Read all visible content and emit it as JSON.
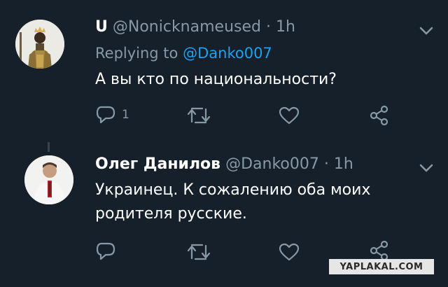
{
  "tweets": [
    {
      "name": "U",
      "handle": "@Nonicknameused",
      "sep": "·",
      "time": "1h",
      "replying_prefix": "Replying to",
      "replying_handle": "@Danko007",
      "text": "А вы кто по национальности?",
      "reply_count": "1",
      "avatar_icon": "knight-armor-avatar"
    },
    {
      "name": "Олег Данилов",
      "handle": "@Danko007",
      "sep": "·",
      "time": "1h",
      "text_line1": "Украинец. К сожалению оба моих",
      "text_line2": "родителя русские.",
      "avatar_icon": "man-embroidered-shirt-avatar"
    }
  ],
  "watermark": "YAPLAKAL.COM",
  "colors": {
    "background": "#15202b",
    "muted": "#8899a6",
    "link": "#1da1f2"
  }
}
